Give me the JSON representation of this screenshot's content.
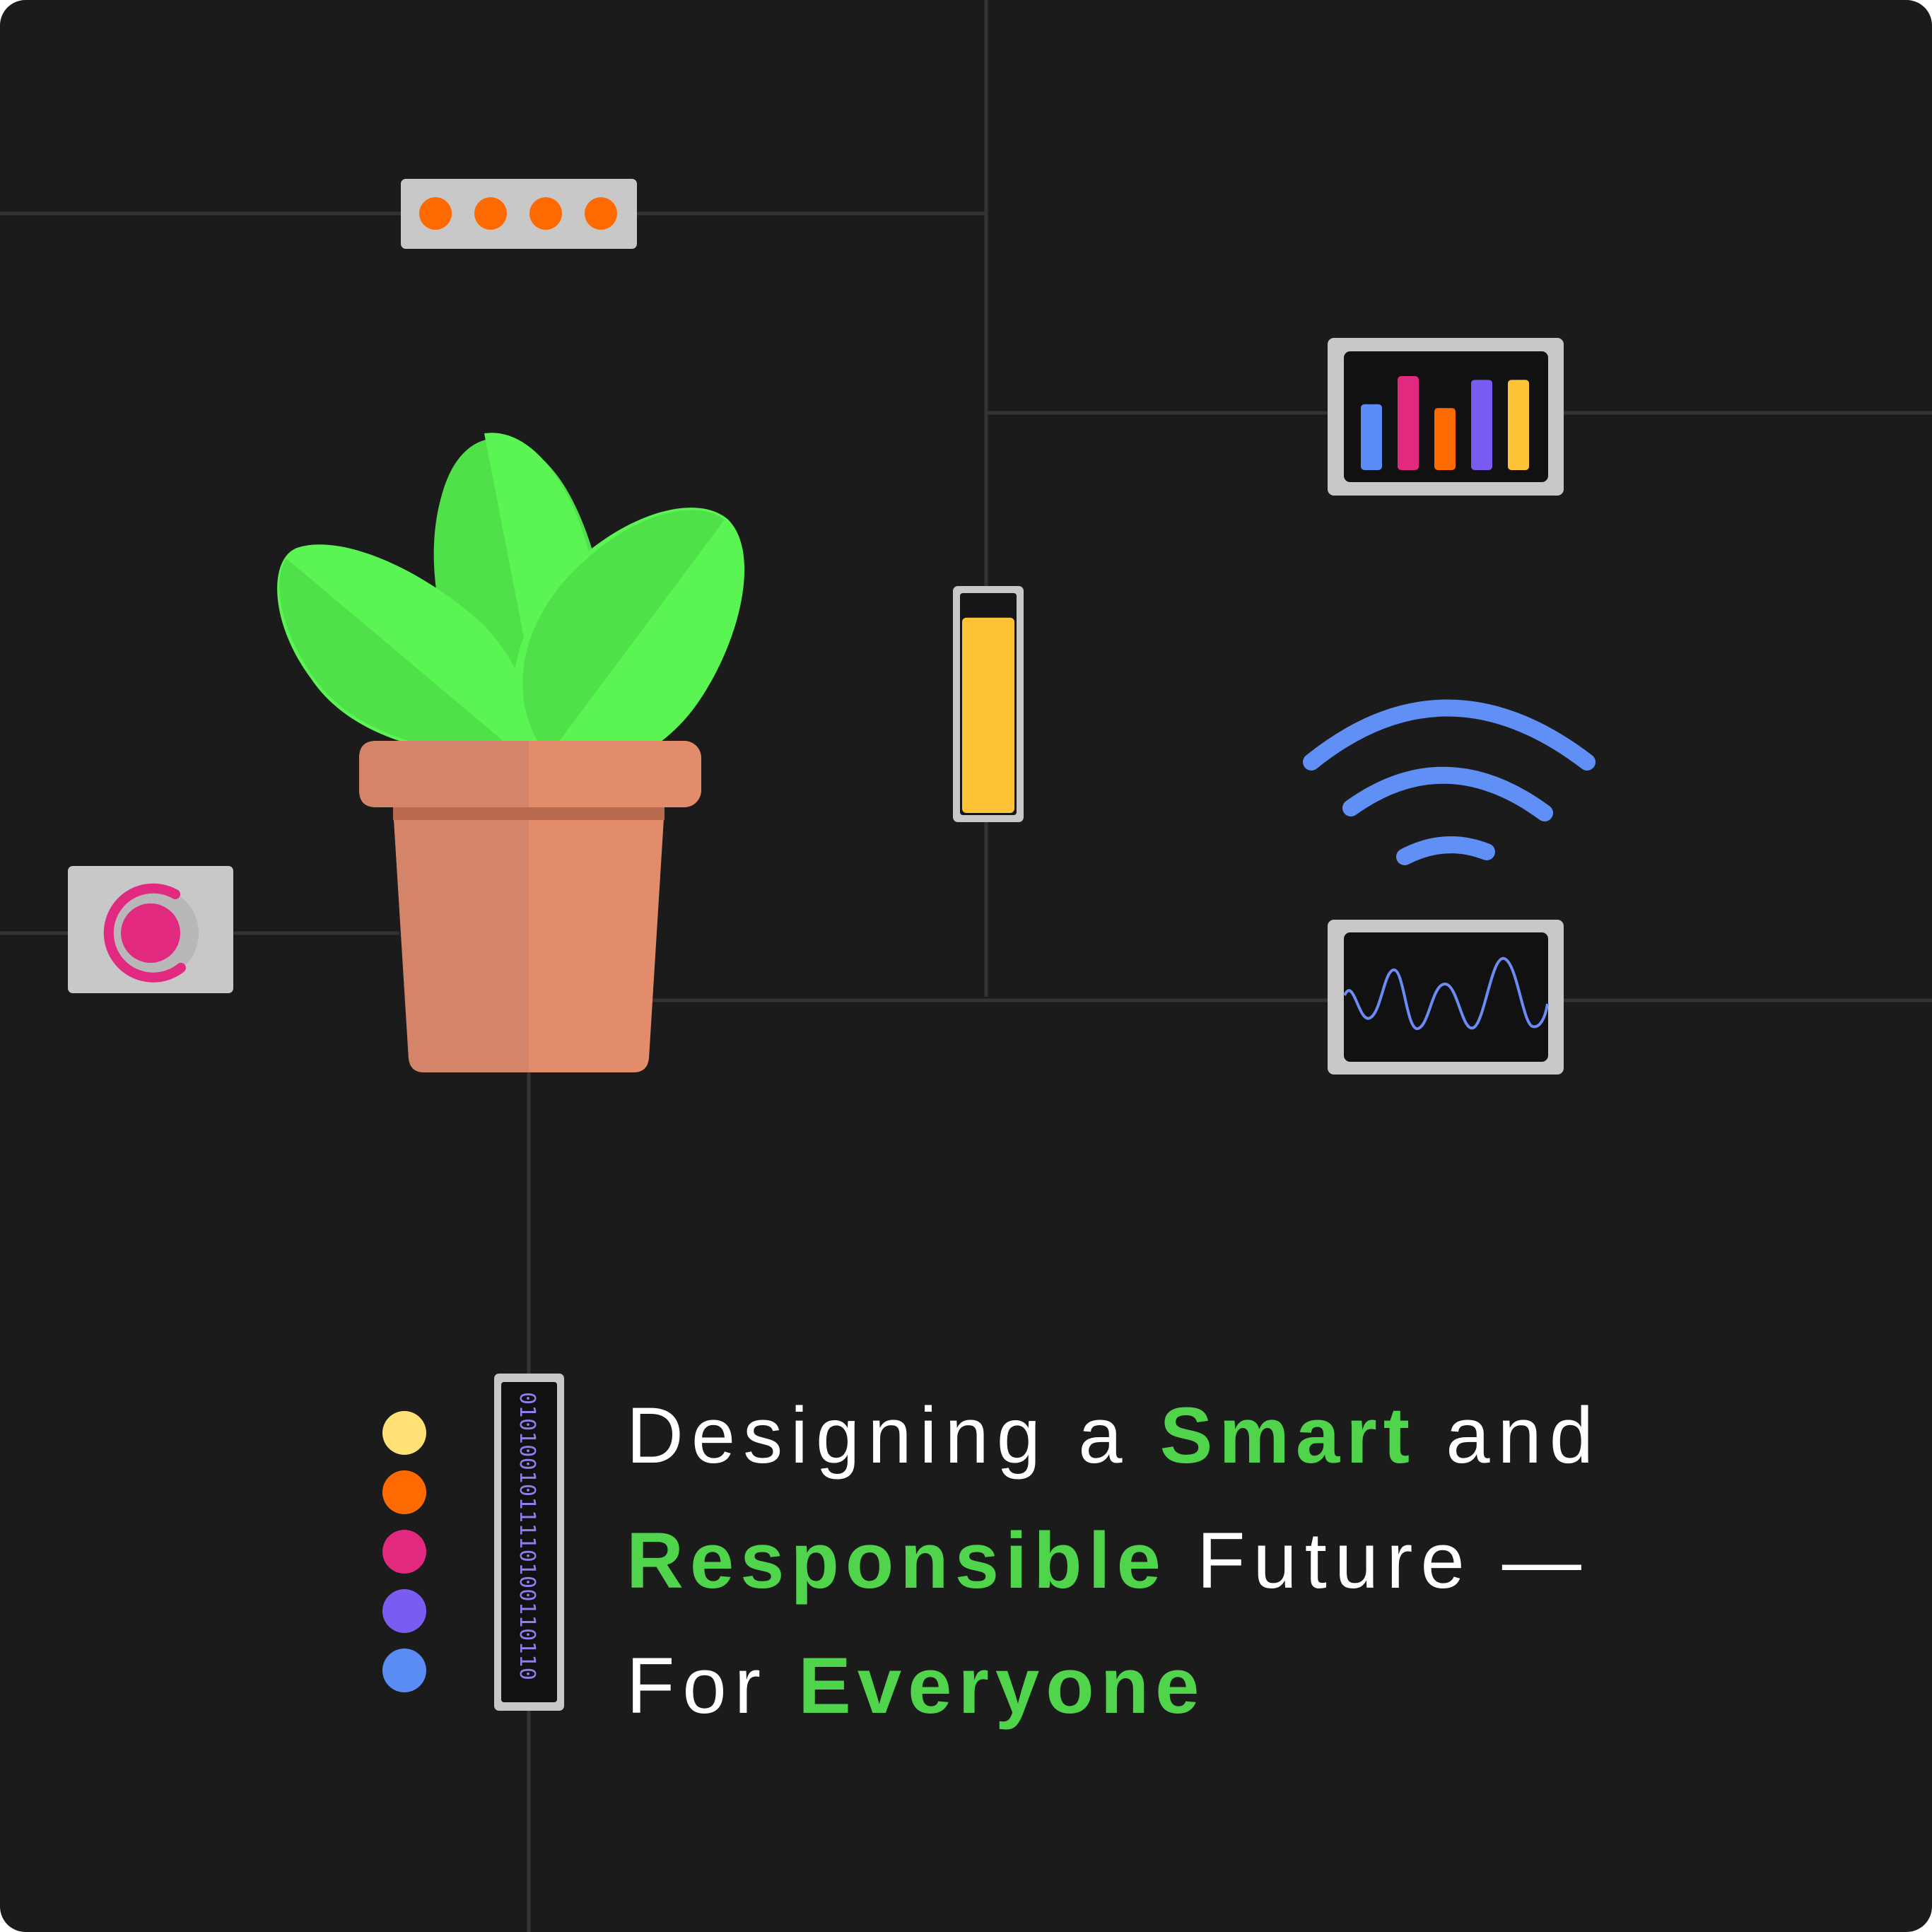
{
  "headline": {
    "line1": {
      "pre": "Designing a",
      "accent": "Smart",
      "post": "and"
    },
    "line2": {
      "accent": "Responsible",
      "post": "Future —"
    },
    "line3": {
      "pre": "For",
      "accent": "Everyone"
    }
  },
  "binary_strip": {
    "bits": "0101001011110100110110"
  },
  "mini_bar_chart": {
    "bars": [
      {
        "value": 0.7,
        "color": "#5b8cf6"
      },
      {
        "value": 1.0,
        "color": "#e0297f"
      },
      {
        "value": 0.66,
        "color": "#ff6a00"
      },
      {
        "value": 0.96,
        "color": "#7b5cf0"
      },
      {
        "value": 0.96,
        "color": "#ffc337"
      }
    ]
  },
  "battery": {
    "level": 0.9,
    "color": "#ffc337"
  },
  "status_lights": {
    "count": 4,
    "color": "#ff6a00"
  },
  "color_dots": [
    "#ffe176",
    "#ff6a00",
    "#e0297f",
    "#7b5cf0",
    "#5b8cf6"
  ],
  "colors": {
    "background": "#1b1b1b",
    "grid_line": "#333333",
    "device_frame": "#c8c8c8",
    "screen": "#111111",
    "accent_green": "#4fd44b",
    "signal_blue": "#6090f5",
    "dial_pink": "#e0297f",
    "pot": "#e38c6c",
    "leaf": "#56f052"
  },
  "icons": [
    "potted-plant-icon",
    "wifi-signal-icon",
    "waveform-monitor-icon",
    "bar-chart-monitor-icon",
    "battery-icon",
    "status-lights-icon",
    "dial-button-icon",
    "binary-strip-icon"
  ]
}
